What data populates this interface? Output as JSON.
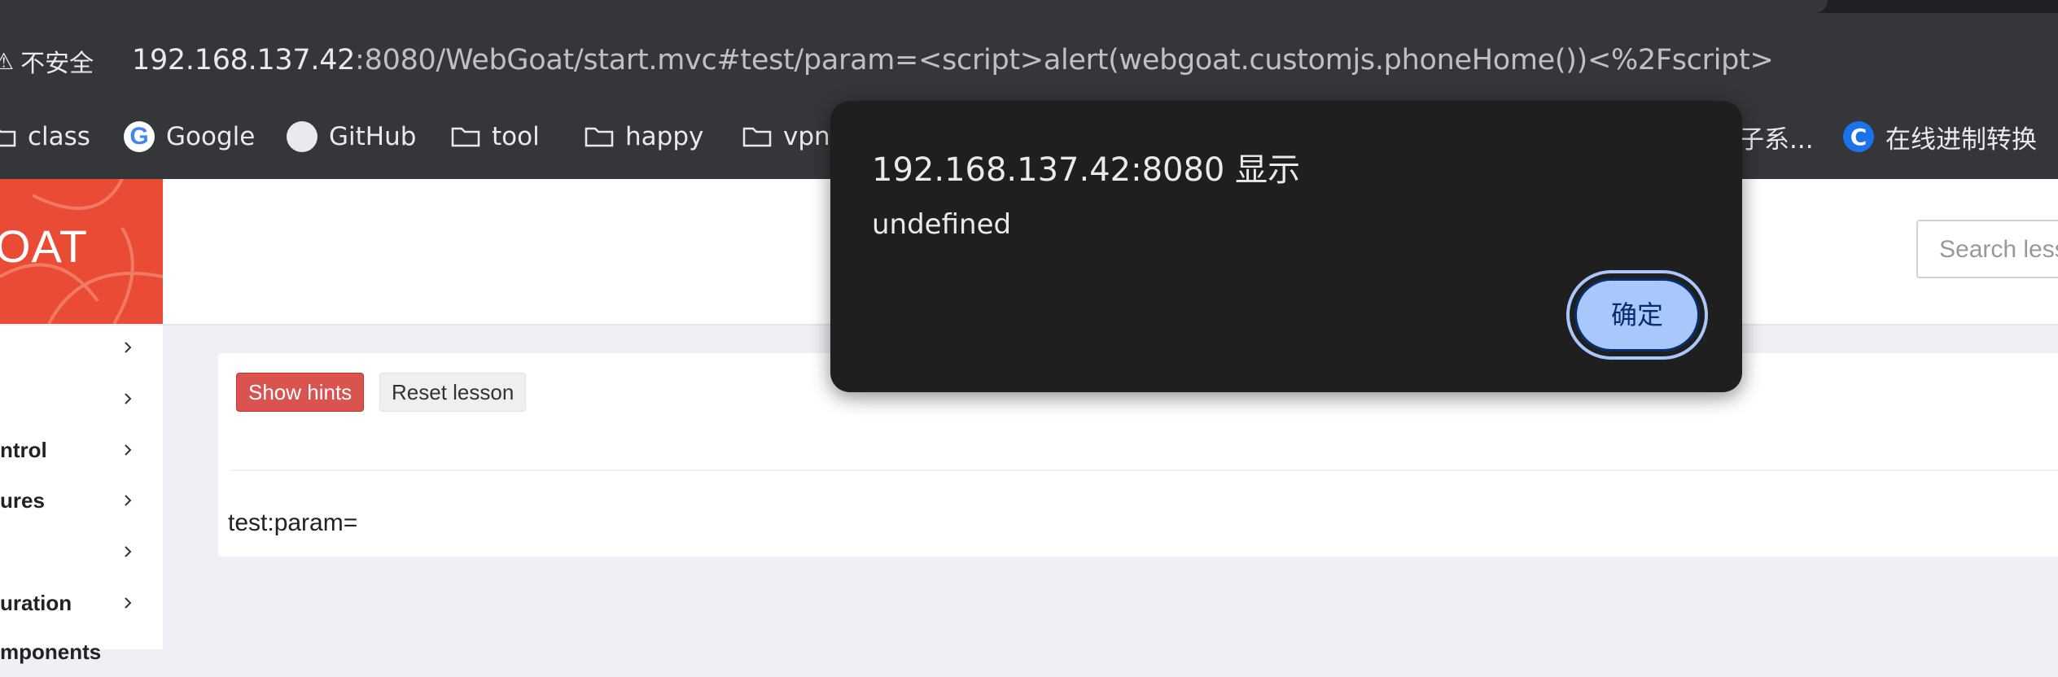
{
  "browser": {
    "security_label": "不安全",
    "url_host": "192.168.137.42",
    "url_rest": ":8080/WebGoat/start.mvc#test/param=<script>alert(webgoat.customjs.phoneHome())<%2Fscript>",
    "bookmarks": [
      {
        "label": "class",
        "icon": "folder-icon"
      },
      {
        "label": "Google",
        "icon": "google-icon"
      },
      {
        "label": "GitHub",
        "icon": "github-icon"
      },
      {
        "label": "tool",
        "icon": "folder-icon"
      },
      {
        "label": "happy",
        "icon": "folder-icon"
      },
      {
        "label": "vpn",
        "icon": "folder-icon"
      },
      {
        "label": "子系...",
        "icon": "folder-icon"
      },
      {
        "label": "在线进制转换",
        "icon": "converter-icon"
      }
    ]
  },
  "app": {
    "logo_text": "OAT",
    "search_placeholder": "Search lessons",
    "sidebar": [
      {
        "label": ""
      },
      {
        "label": ""
      },
      {
        "label": "ntrol"
      },
      {
        "label": "ures"
      },
      {
        "label": ""
      },
      {
        "label": "uration"
      },
      {
        "label": "mponents"
      }
    ],
    "buttons": {
      "show_hints": "Show hints",
      "reset_lesson": "Reset lesson"
    },
    "route_text": "test:param="
  },
  "dialog": {
    "title": "192.168.137.42:8080 显示",
    "message": "undefined",
    "ok_label": "确定"
  },
  "colors": {
    "browser_chrome": "#35363a",
    "logo_bg": "#e94b35",
    "hint_button": "#d9534f",
    "dialog_bg": "#1f1f1f",
    "dialog_button": "#a8c7fa"
  }
}
